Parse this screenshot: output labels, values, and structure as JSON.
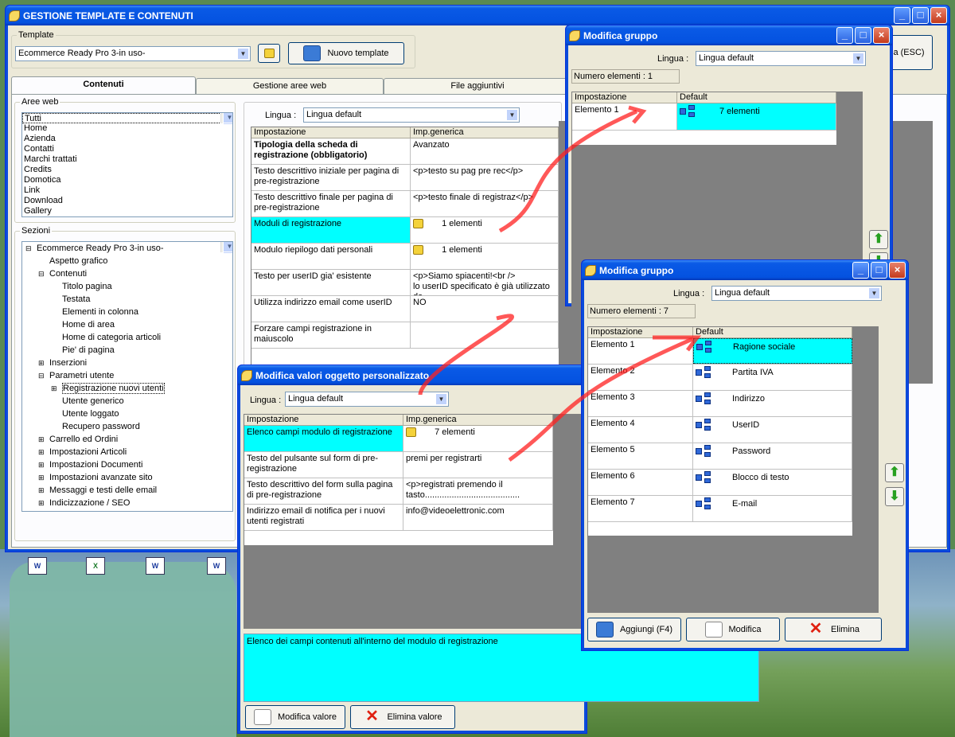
{
  "main": {
    "title": "GESTIONE TEMPLATE E CONTENUTI",
    "template_label": "Template",
    "template_value": "Ecommerce Ready Pro 3-in uso-",
    "new_template_btn": "Nuovo template",
    "esc_btn": "a (ESC)",
    "tabs": [
      "Contenuti",
      "Gestione aree web",
      "File aggiuntivi"
    ],
    "aree_label": "Aree web",
    "aree": [
      "Tutti",
      "Home",
      "Azienda",
      "Contatti",
      "Marchi trattati",
      "Credits",
      "Domotica",
      "Link",
      "Download",
      "Gallery"
    ],
    "sezioni_label": "Sezioni",
    "sezioni": [
      {
        "t": "Ecommerce Ready Pro 3-in uso-",
        "lvl": 0,
        "exp": "⊟"
      },
      {
        "t": "Aspetto grafico",
        "lvl": 1,
        "exp": ""
      },
      {
        "t": "Contenuti",
        "lvl": 1,
        "exp": "⊟"
      },
      {
        "t": "Titolo pagina",
        "lvl": 2,
        "exp": ""
      },
      {
        "t": "Testata",
        "lvl": 2,
        "exp": ""
      },
      {
        "t": "Elementi in colonna",
        "lvl": 2,
        "exp": ""
      },
      {
        "t": "Home di area",
        "lvl": 2,
        "exp": ""
      },
      {
        "t": "Home di categoria articoli",
        "lvl": 2,
        "exp": ""
      },
      {
        "t": "Pie' di pagina",
        "lvl": 2,
        "exp": ""
      },
      {
        "t": "Inserzioni",
        "lvl": 1,
        "exp": "⊞"
      },
      {
        "t": "Parametri utente",
        "lvl": 1,
        "exp": "⊟"
      },
      {
        "t": "Registrazione nuovi utenti",
        "lvl": 2,
        "exp": "⊞"
      },
      {
        "t": "Utente generico",
        "lvl": 2,
        "exp": ""
      },
      {
        "t": "Utente loggato",
        "lvl": 2,
        "exp": ""
      },
      {
        "t": "Recupero password",
        "lvl": 2,
        "exp": ""
      },
      {
        "t": "Carrello ed Ordini",
        "lvl": 1,
        "exp": "⊞"
      },
      {
        "t": "Impostazioni Articoli",
        "lvl": 1,
        "exp": "⊞"
      },
      {
        "t": "Impostazioni Documenti",
        "lvl": 1,
        "exp": "⊞"
      },
      {
        "t": "Impostazioni avanzate sito",
        "lvl": 1,
        "exp": "⊞"
      },
      {
        "t": "Messaggi e testi delle email",
        "lvl": 1,
        "exp": "⊞"
      },
      {
        "t": "Indicizzazione / SEO",
        "lvl": 1,
        "exp": "⊞"
      }
    ],
    "lingua_label": "Lingua :",
    "lingua_value": "Lingua default",
    "grid_headers": [
      "Impostazione",
      "Imp.generica"
    ],
    "grid_rows": [
      {
        "k": "Tipologia della scheda di registrazione (obbligatorio)",
        "v": "Avanzato",
        "bold": true
      },
      {
        "k": "Testo descrittivo iniziale per pagina di pre-registrazione",
        "v": "<p>testo su pag pre rec</p>"
      },
      {
        "k": "Testo descrittivo finale per pagina di pre-registrazione",
        "v": "<p>testo finale di registraz</p>"
      },
      {
        "k": "Moduli di registrazione",
        "v": "1 elementi",
        "sel": true,
        "folder": true
      },
      {
        "k": "Modulo riepilogo dati personali",
        "v": "1 elementi",
        "folder": true
      },
      {
        "k": "Testo per userID gia' esistente",
        "v": "<p>Siamo spiacenti!<br />\nlo userID specificato è già utilizzato da"
      },
      {
        "k": "Utilizza indirizzo email come userID",
        "v": "NO"
      },
      {
        "k": "Forzare campi registrazione in maiuscolo",
        "v": ""
      }
    ]
  },
  "mod1": {
    "title": "Modifica gruppo",
    "lingua_label": "Lingua :",
    "lingua_value": "Lingua default",
    "count": "Numero elementi : 1",
    "headers": [
      "Impostazione",
      "Default"
    ],
    "rows": [
      {
        "k": "Elemento 1",
        "v": "7 elementi"
      }
    ]
  },
  "mod2": {
    "title": "Modifica gruppo",
    "lingua_label": "Lingua :",
    "lingua_value": "Lingua default",
    "count": "Numero elementi : 7",
    "headers": [
      "Impostazione",
      "Default"
    ],
    "rows": [
      {
        "k": "Elemento 1",
        "v": "Ragione sociale"
      },
      {
        "k": "Elemento 2",
        "v": "Partita IVA"
      },
      {
        "k": "Elemento 3",
        "v": "Indirizzo"
      },
      {
        "k": "Elemento 4",
        "v": "UserID"
      },
      {
        "k": "Elemento 5",
        "v": "Password"
      },
      {
        "k": "Elemento 6",
        "v": "Blocco di testo"
      },
      {
        "k": "Elemento 7",
        "v": "E-mail"
      }
    ],
    "btn_add": "Aggiungi (F4)",
    "btn_edit": "Modifica",
    "btn_del": "Elimina"
  },
  "val": {
    "title": "Modifica valori oggetto personalizzato",
    "lingua_label": "Lingua :",
    "lingua_value": "Lingua default",
    "headers": [
      "Impostazione",
      "Imp.generica"
    ],
    "rows": [
      {
        "k": "Elenco campi modulo di registrazione",
        "v": "7 elementi",
        "sel": true,
        "folder": true
      },
      {
        "k": "Testo del pulsante sul form di pre-registrazione",
        "v": "premi per registrarti"
      },
      {
        "k": "Testo descrittivo del form sulla pagina di pre-registrazione",
        "v": "<p>registrati premendo il tasto......................................."
      },
      {
        "k": "Indirizzo email di notifica per i nuovi utenti registrati",
        "v": "info@videoelettronic.com"
      }
    ],
    "desc": "Elenco dei campi contenuti all'interno del modulo di registrazione",
    "btn_edit": "Modifica valore",
    "btn_del": "Elimina valore"
  },
  "colors": {
    "selected": "#00ffff",
    "titlebar": "#0a5ae6",
    "annotation": "#ff2020"
  }
}
